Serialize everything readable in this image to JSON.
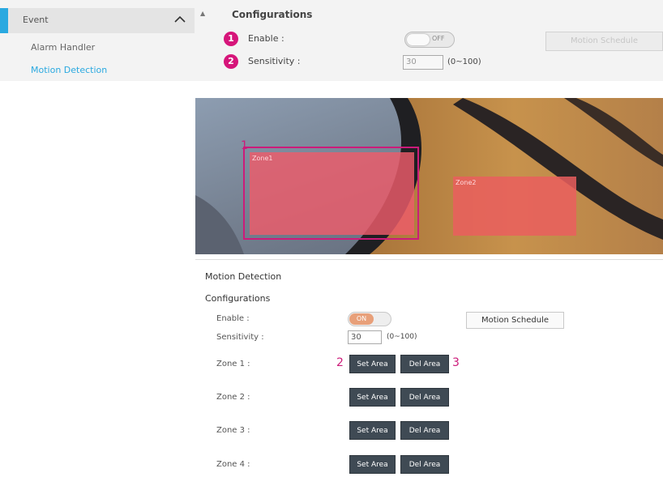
{
  "sidebar": {
    "header": "Event",
    "items": [
      {
        "label": "Alarm Handler"
      },
      {
        "label": "Motion Detection"
      }
    ]
  },
  "top_config": {
    "title": "Configurations",
    "markers": [
      "1",
      "2"
    ],
    "enable_label": "Enable :",
    "toggle_text": "OFF",
    "sensitivity_label": "Sensitivity :",
    "sensitivity_value": "30",
    "range": "(0~100)",
    "schedule_button": "Motion Schedule"
  },
  "camera": {
    "zones": [
      {
        "label": "Zone1"
      },
      {
        "label": "Zone2"
      }
    ]
  },
  "annotations": [
    "1",
    "2",
    "3"
  ],
  "motion_panel": {
    "title": "Motion Detection",
    "configurations": "Configurations",
    "enable_label": "Enable :",
    "toggle_text": "ON",
    "schedule_button": "Motion Schedule",
    "sensitivity_label": "Sensitivity :",
    "sensitivity_value": "30",
    "range": "(0~100)",
    "zones": [
      {
        "label": "Zone 1 :",
        "set": "Set Area",
        "del": "Del Area"
      },
      {
        "label": "Zone 2 :",
        "set": "Set Area",
        "del": "Del Area"
      },
      {
        "label": "Zone 3 :",
        "set": "Set Area",
        "del": "Del Area"
      },
      {
        "label": "Zone 4 :",
        "set": "Set Area",
        "del": "Del Area"
      }
    ]
  },
  "colors": {
    "accent": "#2aa9e0",
    "marker": "#d6157a",
    "zone": "#ee5c6a",
    "button_dark": "#3f4a54"
  }
}
